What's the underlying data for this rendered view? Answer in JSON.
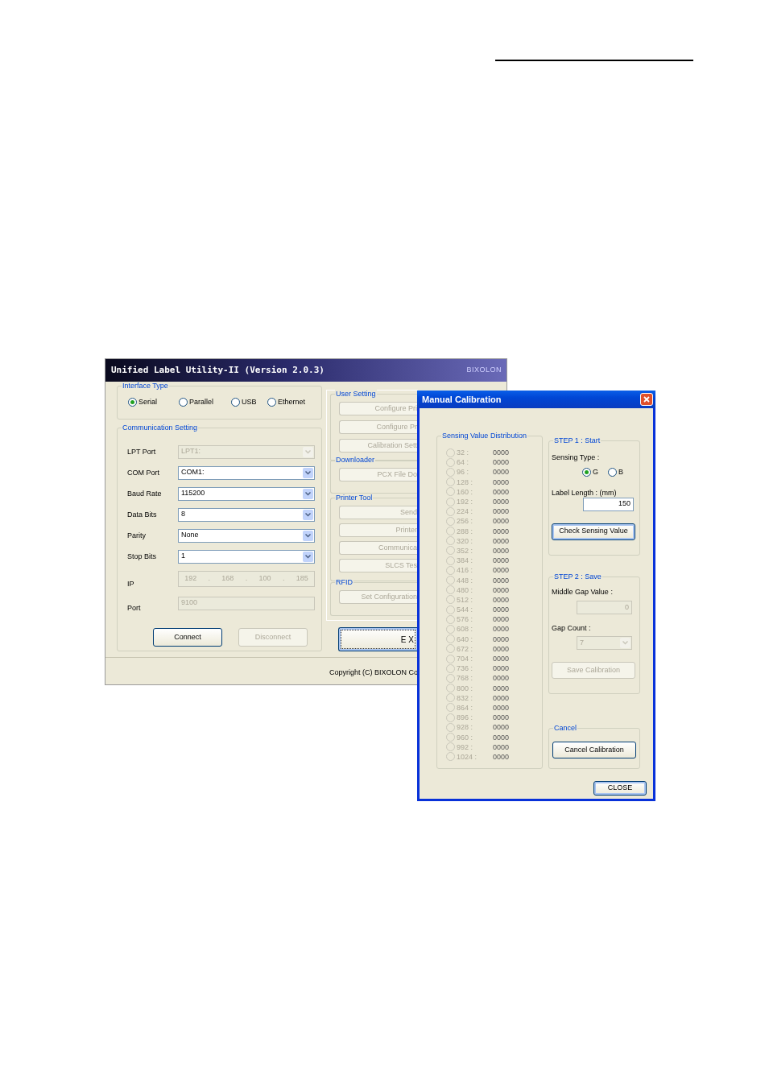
{
  "main_window": {
    "title": "Unified Label Utility-II (Version 2.0.3)",
    "brand": "BIXOLON",
    "interface_type": {
      "legend": "Interface Type",
      "options": [
        {
          "label": "Serial",
          "selected": true
        },
        {
          "label": "Parallel",
          "selected": false
        },
        {
          "label": "USB",
          "selected": false
        },
        {
          "label": "Ethernet",
          "selected": false
        }
      ]
    },
    "communication_setting": {
      "legend": "Communication Setting",
      "fields": [
        {
          "label": "LPT Port",
          "kind": "select",
          "value": "LPT1:",
          "disabled": true
        },
        {
          "label": "COM Port",
          "kind": "select",
          "value": "COM1:",
          "disabled": false
        },
        {
          "label": "Baud Rate",
          "kind": "select",
          "value": "115200",
          "disabled": false
        },
        {
          "label": "Data Bits",
          "kind": "select",
          "value": "8",
          "disabled": false
        },
        {
          "label": "Parity",
          "kind": "select",
          "value": "None",
          "disabled": false
        },
        {
          "label": "Stop Bits",
          "kind": "select",
          "value": "1",
          "disabled": false
        },
        {
          "label": "IP",
          "kind": "ip",
          "parts": [
            "192",
            ".",
            "168",
            ".",
            "100",
            ".",
            "185"
          ],
          "disabled": true
        },
        {
          "label": "Port",
          "kind": "text",
          "value": "9100",
          "disabled": true
        }
      ],
      "buttons": [
        {
          "label": "Connect",
          "disabled": false
        },
        {
          "label": "Disconnect",
          "disabled": true
        }
      ]
    },
    "tool_groups": [
      {
        "legend": "User Setting",
        "buttons": [
          {
            "label": "Configure Pri",
            "disabled": true
          },
          {
            "label": "Configure Pr",
            "disabled": true
          },
          {
            "label": "Calibration Sett",
            "disabled": true
          }
        ]
      },
      {
        "legend": "Downloader",
        "buttons": [
          {
            "label": "PCX File Do",
            "disabled": true
          }
        ]
      },
      {
        "legend": "Printer Tool",
        "buttons": [
          {
            "label": "Send",
            "disabled": true
          },
          {
            "label": "Printer",
            "disabled": true
          },
          {
            "label": "Communica",
            "disabled": true
          },
          {
            "label": "SLCS Tes",
            "disabled": true
          }
        ]
      },
      {
        "legend": "RFID",
        "buttons": [
          {
            "label": "Set Configuration",
            "disabled": true
          }
        ]
      }
    ],
    "exit_button": "EX",
    "copyright": "Copyright (C) BIXOLON Co"
  },
  "dialog": {
    "title": "Manual Calibration",
    "distribution": {
      "legend": "Sensing Value Distribution",
      "rows": [
        {
          "label": "32 :",
          "value": "0000",
          "selected": false
        },
        {
          "label": "64 :",
          "value": "0000",
          "selected": false
        },
        {
          "label": "96 :",
          "value": "0000",
          "selected": false
        },
        {
          "label": "128 :",
          "value": "0000",
          "selected": false
        },
        {
          "label": "160 :",
          "value": "0000",
          "selected": false
        },
        {
          "label": "192 :",
          "value": "0000",
          "selected": false
        },
        {
          "label": "224 :",
          "value": "0000",
          "selected": false
        },
        {
          "label": "256 :",
          "value": "0000",
          "selected": false
        },
        {
          "label": "288 :",
          "value": "0000",
          "selected": false
        },
        {
          "label": "320 :",
          "value": "0000",
          "selected": false
        },
        {
          "label": "352 :",
          "value": "0000",
          "selected": false
        },
        {
          "label": "384 :",
          "value": "0000",
          "selected": false
        },
        {
          "label": "416 :",
          "value": "0000",
          "selected": false
        },
        {
          "label": "448 :",
          "value": "0000",
          "selected": false
        },
        {
          "label": "480 :",
          "value": "0000",
          "selected": false
        },
        {
          "label": "512 :",
          "value": "0000",
          "selected": false
        },
        {
          "label": "544 :",
          "value": "0000",
          "selected": false
        },
        {
          "label": "576 :",
          "value": "0000",
          "selected": false
        },
        {
          "label": "608 :",
          "value": "0000",
          "selected": false
        },
        {
          "label": "640 :",
          "value": "0000",
          "selected": false
        },
        {
          "label": "672 :",
          "value": "0000",
          "selected": false
        },
        {
          "label": "704 :",
          "value": "0000",
          "selected": false
        },
        {
          "label": "736 :",
          "value": "0000",
          "selected": false
        },
        {
          "label": "768 :",
          "value": "0000",
          "selected": false
        },
        {
          "label": "800 :",
          "value": "0000",
          "selected": false
        },
        {
          "label": "832 :",
          "value": "0000",
          "selected": false
        },
        {
          "label": "864 :",
          "value": "0000",
          "selected": false
        },
        {
          "label": "896 :",
          "value": "0000",
          "selected": false
        },
        {
          "label": "928 :",
          "value": "0000",
          "selected": false
        },
        {
          "label": "960 :",
          "value": "0000",
          "selected": false
        },
        {
          "label": "992 :",
          "value": "0000",
          "selected": false
        },
        {
          "label": "1024 :",
          "value": "0000",
          "selected": false
        }
      ]
    },
    "step1": {
      "legend": "STEP 1 : Start",
      "sensing_type_label": "Sensing Type :",
      "sensing_types": [
        {
          "label": "G",
          "selected": true
        },
        {
          "label": "B",
          "selected": false
        }
      ],
      "label_length_label": "Label Length : (mm)",
      "label_length": "150",
      "button": "Check Sensing Value"
    },
    "step2": {
      "legend": "STEP 2 : Save",
      "middle_gap_label": "Middle Gap Value :",
      "middle_gap": "0",
      "middle_gap_disabled": true,
      "gap_count_label": "Gap Count :",
      "gap_count": "7",
      "gap_count_disabled": true,
      "button": "Save Calibration",
      "button_disabled": true
    },
    "cancel": {
      "legend": "Cancel",
      "button": "Cancel Calibration"
    },
    "close_button": "CLOSE"
  }
}
